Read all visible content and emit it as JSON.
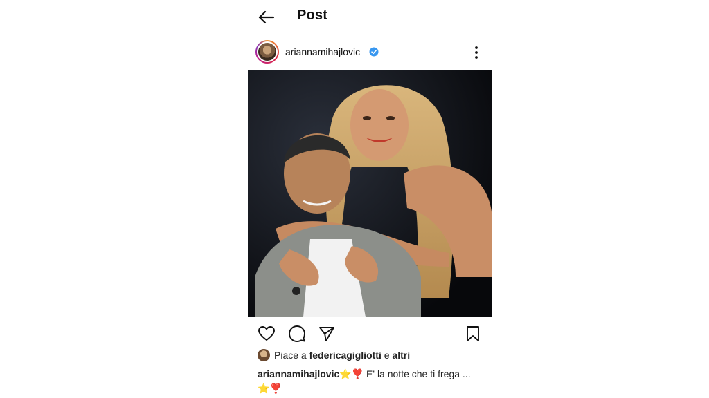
{
  "topbar": {
    "title": "Post",
    "back_icon": "arrow-left-icon"
  },
  "post": {
    "username": "ariannamihajlovic",
    "verified": true,
    "verified_color": "#3897f0",
    "more_icon": "more-vertical-icon",
    "image_alt": "photo",
    "actions": {
      "like_icon": "heart-icon",
      "comment_icon": "comment-icon",
      "share_icon": "send-icon",
      "save_icon": "bookmark-icon"
    },
    "likes": {
      "prefix": "Piace a",
      "user": "federicagigliotti",
      "connector": "e",
      "others": "altri"
    },
    "caption": {
      "username": "ariannamihajlovic",
      "emoji_star": "⭐",
      "emoji_heart": "❣️",
      "text": "E' la notte che ti frega ...",
      "emoji_star_2": "⭐",
      "emoji_heart_2": "❣️"
    }
  },
  "colors": {
    "accent": "#3897f0",
    "text": "#111111",
    "background": "#ffffff"
  }
}
